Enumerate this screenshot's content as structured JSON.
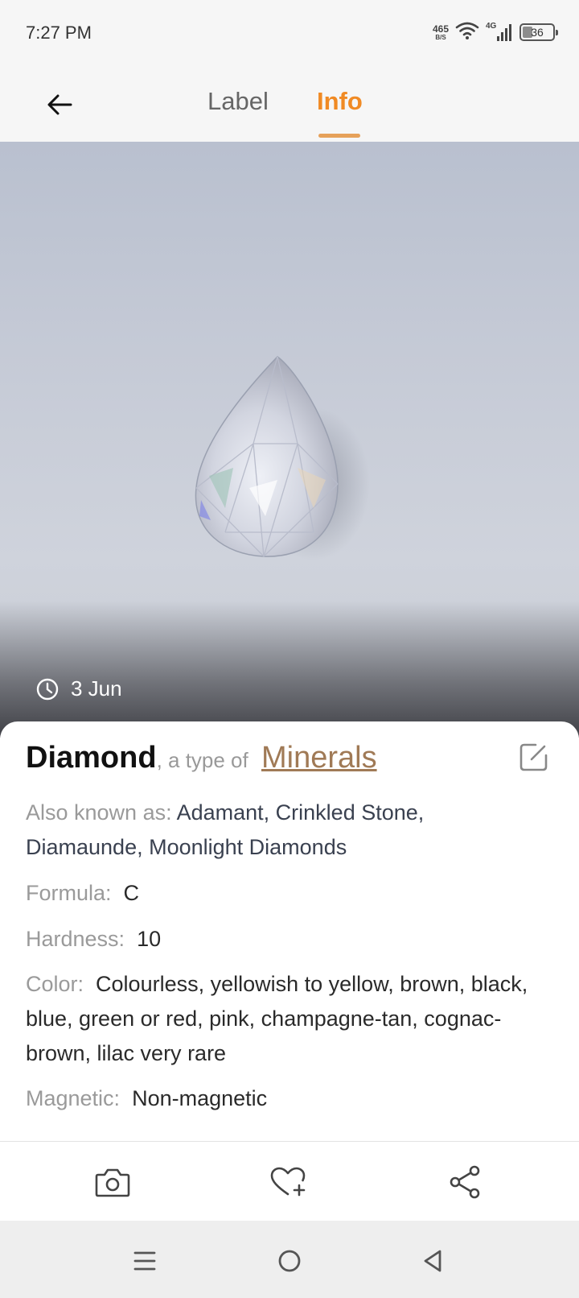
{
  "status_bar": {
    "time": "7:27 PM",
    "net_speed": "465",
    "net_speed_unit": "B/S",
    "network": "4G",
    "battery": "36"
  },
  "header": {
    "tabs": [
      {
        "label": "Label",
        "active": false
      },
      {
        "label": "Info",
        "active": true
      }
    ],
    "accent_color": "#f08a24"
  },
  "photo": {
    "date": "3 Jun"
  },
  "info": {
    "name": "Diamond",
    "type_of": ", a type of ",
    "category": "Minerals",
    "fields": {
      "aka_label": "Also known as: ",
      "aka_value": "Adamant, Crinkled Stone, Diamaunde, Moonlight Diamonds",
      "formula_label": "Formula:",
      "formula_value": "C",
      "hardness_label": "Hardness:",
      "hardness_value": "10",
      "color_label": "Color:",
      "color_value": "Colourless, yellowish to yellow, brown, black, blue, green or red, pink, champagne-tan, cognac-brown, lilac very rare",
      "magnetic_label": "Magnetic:",
      "magnetic_value": "Non-magnetic"
    }
  },
  "actions": {
    "icons": [
      "camera-icon",
      "heart-plus-icon",
      "share-icon"
    ]
  },
  "system_nav": {
    "icons": [
      "menu-icon",
      "home-icon",
      "back-triangle-icon"
    ]
  }
}
